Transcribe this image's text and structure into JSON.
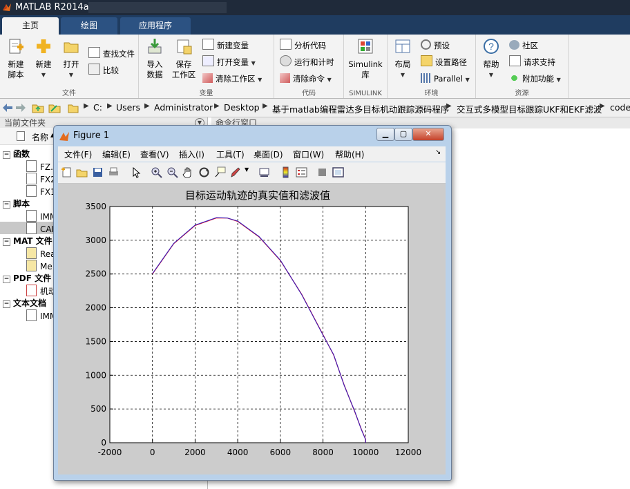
{
  "app": {
    "title": "MATLAB R2014a"
  },
  "tabs": [
    {
      "label": "主页",
      "active": true
    },
    {
      "label": "绘图",
      "active": false
    },
    {
      "label": "应用程序",
      "active": false
    }
  ],
  "ribbon": {
    "file": {
      "group_label": "文件",
      "new_script": [
        "新建",
        "脚本"
      ],
      "new": "新建",
      "open": "打开",
      "find_files": "查找文件",
      "compare": "比较"
    },
    "variable": {
      "group_label": "变量",
      "import": [
        "导入",
        "数据"
      ],
      "save": [
        "保存",
        "工作区"
      ],
      "new_var": "新建变量",
      "open_var": "打开变量",
      "clear_ws": "清除工作区"
    },
    "code": {
      "group_label": "代码",
      "analyze": "分析代码",
      "run_time": "运行和计时",
      "clear_cmd": "清除命令"
    },
    "simulink": {
      "group_label": "SIMULINK",
      "lib": [
        "Simulink",
        "库"
      ]
    },
    "env": {
      "group_label": "环境",
      "layout": "布局",
      "prefs": "预设",
      "set_path": "设置路径",
      "parallel": "Parallel"
    },
    "resources": {
      "group_label": "资源",
      "help": "帮助",
      "community": "社区",
      "support": "请求支持",
      "addons": "附加功能"
    }
  },
  "address": {
    "crumbs": [
      "C:",
      "Users",
      "Administrator",
      "Desktop",
      "基于matlab编程雷达多目标机动跟踪源码程序",
      "交互式多模型目标跟踪UKF和EKF滤波",
      "code"
    ]
  },
  "left_panel": {
    "title": "当前文件夹",
    "col_name": "名称",
    "sort_arrow": "▲",
    "groups": [
      {
        "label": "函数",
        "items": [
          "FZ.r",
          "FX2",
          "FX1"
        ]
      },
      {
        "label": "脚本",
        "items": [
          "IMM",
          "CAE"
        ]
      },
      {
        "label": "MAT 文件",
        "items": [
          "Rea",
          "Me"
        ]
      },
      {
        "label": "PDF 文件",
        "items": [
          "机动"
        ]
      },
      {
        "label": "文本文档",
        "items": [
          "IMM"
        ]
      }
    ]
  },
  "right_panel": {
    "title": "命令行窗口"
  },
  "figure": {
    "title": "Figure 1",
    "menu": [
      "文件(F)",
      "编辑(E)",
      "查看(V)",
      "插入(I)",
      "工具(T)",
      "桌面(D)",
      "窗口(W)",
      "帮助(H)"
    ],
    "dock_arrow": "↘"
  },
  "chart_data": {
    "type": "line",
    "title": "目标运动轨迹的真实值和滤波值",
    "xlabel": "",
    "ylabel": "",
    "xlim": [
      -2000,
      12000
    ],
    "ylim": [
      0,
      3500
    ],
    "xticks": [
      -2000,
      0,
      2000,
      4000,
      6000,
      8000,
      10000,
      12000
    ],
    "yticks": [
      0,
      500,
      1000,
      1500,
      2000,
      2500,
      3000,
      3500
    ],
    "grid": true,
    "series": [
      {
        "color": "#ff0000",
        "x": [
          0,
          1000,
          2000,
          3000,
          3500,
          4000,
          5000,
          6000,
          7000,
          8000,
          8500,
          9000,
          9500,
          9800,
          10000,
          10000
        ],
        "y": [
          2500,
          2950,
          3220,
          3330,
          3330,
          3280,
          3050,
          2700,
          2200,
          1600,
          1300,
          850,
          450,
          200,
          50,
          0
        ]
      },
      {
        "color": "#2020d0",
        "x": [
          0,
          1000,
          2000,
          3000,
          3500,
          4000,
          5000,
          6000,
          7000,
          8000,
          8500,
          9000,
          9500,
          9800,
          10000,
          10000
        ],
        "y": [
          2505,
          2955,
          3225,
          3335,
          3330,
          3285,
          3055,
          2705,
          2195,
          1595,
          1305,
          845,
          455,
          195,
          45,
          0
        ]
      }
    ]
  }
}
